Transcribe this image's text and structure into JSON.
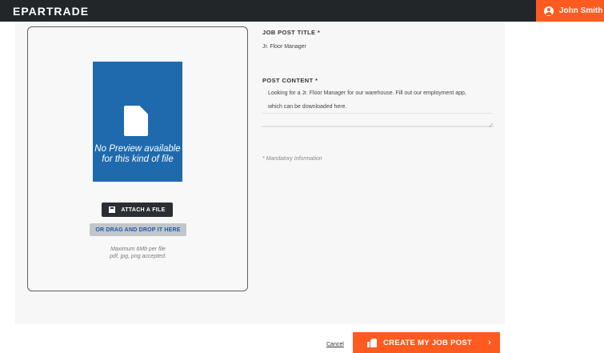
{
  "header": {
    "logo": "EPARTRADE",
    "user_name": "John Smith"
  },
  "upload": {
    "preview_text": "No Preview available for this kind of file",
    "attach_label": "ATTACH A FILE",
    "drag_label": "OR DRAG AND DROP IT HERE",
    "limit_line1": "Maximum 6Mb per file",
    "limit_line2": "pdf, jpg, png accepted."
  },
  "form": {
    "title_label": "JOB POST TITLE *",
    "title_value": "Jr. Floor Manager",
    "content_label": "POST CONTENT *",
    "content_line1": "Looking for a Jr. Floor Manager for our warehouse. Fill out our employment app,",
    "content_line2": "which can be downloaded here.",
    "mandatory_note": "* Mandatory Information"
  },
  "actions": {
    "cancel_label": "Cancel",
    "create_label": "CREATE MY JOB POST",
    "create_chevron": "›"
  },
  "colors": {
    "accent": "#ff5a1f",
    "header_bg": "#232628",
    "preview_bg": "#1e6aad"
  }
}
